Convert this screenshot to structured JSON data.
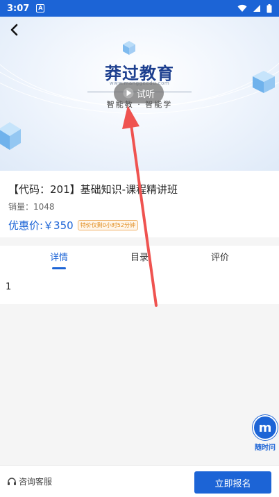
{
  "status_bar": {
    "time": "3:07",
    "notif_letter": "A"
  },
  "hero": {
    "brand_name": "莽过教育",
    "brand_url": "www.manggeedu.com",
    "slogan": "智能教 · 智能学",
    "trial_label": "试听"
  },
  "course": {
    "title": "【代码：201】基础知识-课程精讲班",
    "sales": "销量：1048",
    "price": "优惠价:￥350",
    "promo": "特价仅剩0小时52分钟"
  },
  "tabs": [
    {
      "label": "详情",
      "active": true
    },
    {
      "label": "目录",
      "active": false
    },
    {
      "label": "评价",
      "active": false
    }
  ],
  "detail": {
    "content": "1"
  },
  "float_widget": {
    "glyph": "m",
    "label": "随时问"
  },
  "bottom_bar": {
    "service_label": "咨询客服",
    "enroll_label": "立即报名"
  },
  "colors": {
    "accent": "#1c64d6",
    "promo": "#e08a1a",
    "arrow": "#ef5350"
  }
}
